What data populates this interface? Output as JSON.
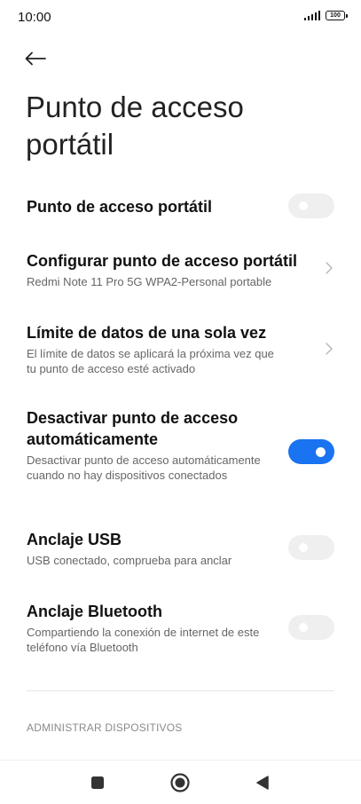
{
  "status_bar": {
    "time": "10:00",
    "battery": "100",
    "icons": [
      "signal-icon",
      "battery-icon"
    ]
  },
  "header": {
    "back_icon": "arrow-left-icon",
    "title": "Punto de acceso portátil"
  },
  "settings": [
    {
      "title": "Punto de acceso portátil",
      "subtitle": "",
      "control": "toggle",
      "enabled": false
    },
    {
      "title": "Configurar punto de acceso portátil",
      "subtitle": "Redmi Note 11 Pro 5G WPA2-Personal portable",
      "control": "chevron"
    },
    {
      "title": "Límite de datos de una sola vez",
      "subtitle": "El límite de datos se aplicará la próxima vez que tu punto de acceso esté activado",
      "control": "chevron"
    },
    {
      "title": "Desactivar punto de acceso automáticamente",
      "subtitle": "Desactivar punto de acceso automáticamente cuando no hay dispositivos conectados",
      "control": "toggle",
      "enabled": true
    },
    {
      "title": "Anclaje USB",
      "subtitle": "USB conectado, comprueba para anclar",
      "control": "toggle",
      "enabled": false
    },
    {
      "title": "Anclaje Bluetooth",
      "subtitle": "Compartiendo la conexión de internet de este teléfono vía Bluetooth",
      "control": "toggle",
      "enabled": false
    }
  ],
  "section": {
    "label": "ADMINISTRAR DISPOSITIVOS"
  },
  "nav_bar": {
    "icons": [
      "recents-square-icon",
      "home-circle-icon",
      "back-triangle-icon"
    ]
  },
  "colors": {
    "accent": "#1a73f0",
    "toggle_off": "#efefef",
    "subtitle": "#666666"
  }
}
